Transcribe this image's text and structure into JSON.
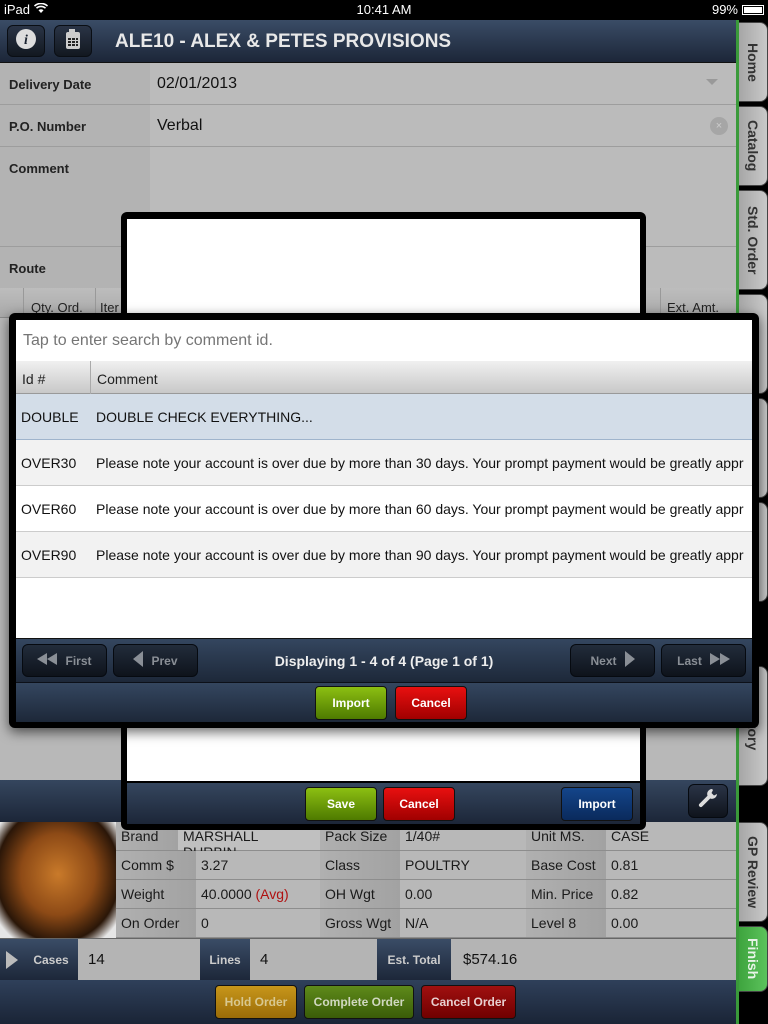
{
  "status_bar": {
    "device": "iPad",
    "time": "10:41 AM",
    "battery": "99%"
  },
  "header": {
    "title": "ALE10 - ALEX & PETES PROVISIONS",
    "info_icon": "info-icon",
    "calculator_icon": "calculator-icon"
  },
  "form": {
    "delivery_date": {
      "label": "Delivery Date",
      "value": "02/01/2013"
    },
    "po_number": {
      "label": "P.O. Number",
      "value": "Verbal"
    },
    "comment": {
      "label": "Comment",
      "value": ""
    },
    "route": {
      "label": "Route",
      "value": ""
    }
  },
  "grid_header": {
    "qty_ord": "Qty. Ord.",
    "item": "Iter",
    "ext_amt": "Ext. Amt."
  },
  "comment_dialog": {
    "search_placeholder": "Tap to enter search by comment id.",
    "columns": [
      "Id #",
      "Comment"
    ],
    "rows": [
      {
        "id": "DOUBLE",
        "comment": "DOUBLE CHECK EVERYTHING...",
        "selected": true
      },
      {
        "id": "OVER30",
        "comment": "Please note your account is over due by more than 30 days. Your prompt payment would be greatly appr"
      },
      {
        "id": "OVER60",
        "comment": "Please note your account is over due by more than 60 days. Your prompt payment would be greatly appr"
      },
      {
        "id": "OVER90",
        "comment": "Please note your account is over due by more than 90 days. Your prompt payment would be greatly appr"
      }
    ],
    "pager": {
      "first": "First",
      "prev": "Prev",
      "next": "Next",
      "last": "Last",
      "info": "Displaying 1 - 4 of 4 (Page 1 of 1)"
    },
    "import_label": "Import",
    "cancel_label": "Cancel"
  },
  "back_dialog": {
    "save_label": "Save",
    "cancel_label": "Cancel",
    "import_label": "Import"
  },
  "product_details": {
    "brand": {
      "label": "Brand",
      "value": "MARSHALL DURBIN"
    },
    "pack_size": {
      "label": "Pack Size",
      "value": "1/40#"
    },
    "unit_ms": {
      "label": "Unit MS.",
      "value": "CASE"
    },
    "comm": {
      "label": "Comm $",
      "value": "3.27"
    },
    "class": {
      "label": "Class",
      "value": "POULTRY"
    },
    "base_cost": {
      "label": "Base Cost",
      "value": "0.81"
    },
    "weight": {
      "label": "Weight",
      "value": "40.0000",
      "note": "(Avg)"
    },
    "oh_wgt": {
      "label": "OH Wgt",
      "value": "0.00"
    },
    "min_price": {
      "label": "Min. Price",
      "value": "0.82"
    },
    "on_order": {
      "label": "On Order",
      "value": "0"
    },
    "gross_wgt": {
      "label": "Gross Wgt",
      "value": "N/A"
    },
    "level8": {
      "label": "Level 8",
      "value": "0.00"
    }
  },
  "totals": {
    "cases": {
      "label": "Cases",
      "value": "14"
    },
    "lines": {
      "label": "Lines",
      "value": "4"
    },
    "est_total": {
      "label": "Est. Total",
      "value": "$574.16"
    }
  },
  "footer": {
    "hold_order": "Hold Order",
    "complete_order": "Complete Order",
    "cancel_order": "Cancel Order"
  },
  "side_tabs": [
    {
      "label": "Home"
    },
    {
      "label": "Catalog"
    },
    {
      "label": "Std. Order"
    },
    {
      "label": "History"
    },
    {
      "label": "GP Review"
    },
    {
      "label": "Finish",
      "active": true
    }
  ],
  "colors": {
    "accent_green": "#3ea43e",
    "import_green": "#8cbf12",
    "cancel_red": "#e81010",
    "import_blue": "#14458a",
    "hold_yellow": "#c7961a",
    "selected_row": "#d3dde8"
  }
}
